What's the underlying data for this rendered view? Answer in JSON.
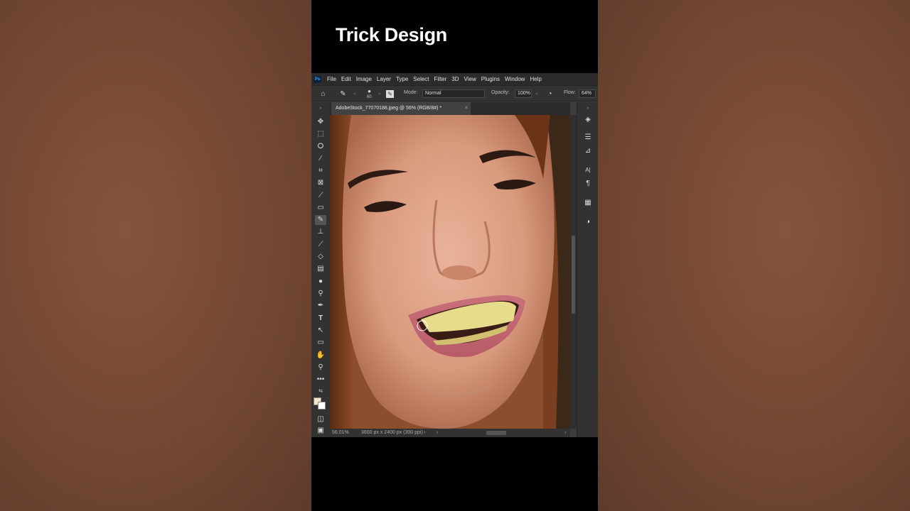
{
  "video_title": "Trick Design",
  "menu": [
    "File",
    "Edit",
    "Image",
    "Layer",
    "Type",
    "Select",
    "Filter",
    "3D",
    "View",
    "Plugins",
    "Window",
    "Help"
  ],
  "ps_logo": "Ps",
  "options": {
    "brush_size": "60",
    "mode_label": "Mode:",
    "mode_value": "Normal",
    "opacity_label": "Opacity:",
    "opacity_value": "100%",
    "flow_label": "Flow:",
    "flow_value": "64%"
  },
  "document_tab": {
    "title": "AdobeStock_77070188.jpeg @ 56% (RGB/8#) *",
    "close": "×"
  },
  "status": {
    "zoom": "56.01%",
    "dimensions": "3600 px x 2400 px (300 ppi)"
  },
  "colors": {
    "foreground": "#f4e4c8",
    "background": "#ffffff",
    "ps_accent": "#31a8ff"
  },
  "tools": [
    "move-icon",
    "marquee-icon",
    "lasso-icon",
    "quick-select-icon",
    "crop-icon",
    "frame-icon",
    "eyedropper-icon",
    "patch-icon",
    "brush-icon",
    "stamp-icon",
    "history-brush-icon",
    "eraser-icon",
    "gradient-icon",
    "blur-icon",
    "dodge-icon",
    "pen-icon",
    "type-icon",
    "path-select-icon",
    "rectangle-icon",
    "hand-icon",
    "zoom-icon",
    "more-tools-icon"
  ]
}
